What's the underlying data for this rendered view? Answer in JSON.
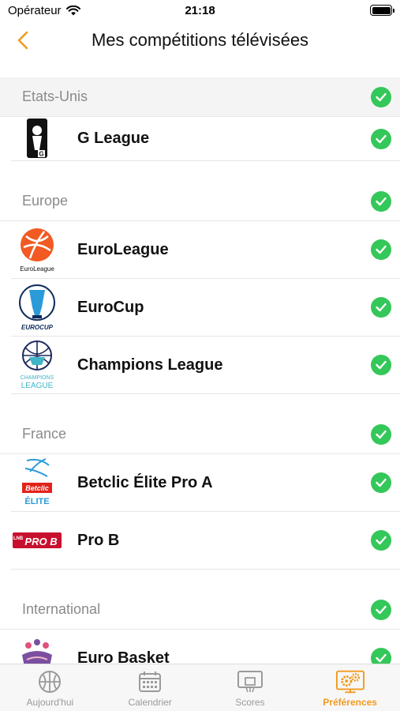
{
  "status": {
    "carrier": "Opérateur",
    "time": "21:18"
  },
  "nav": {
    "title": "Mes compétitions télévisées"
  },
  "sections": [
    {
      "name": "Etats-Unis",
      "items": [
        "G League"
      ]
    },
    {
      "name": "Europe",
      "items": [
        "EuroLeague",
        "EuroCup",
        "Champions League"
      ]
    },
    {
      "name": "France",
      "items": [
        "Betclic Élite Pro A",
        "Pro B"
      ]
    },
    {
      "name": "International",
      "items": [
        "Euro Basket"
      ]
    }
  ],
  "logo_text": {
    "euroleague": "EuroLeague",
    "eurocup": "EUROCUP",
    "champions_1": "CHAMPIONS",
    "champions_2": "LEAGUE",
    "betclic": "Betclic",
    "elite": "ÉLITE",
    "prob": "PRO B",
    "lnb": "LNB"
  },
  "tabs": [
    {
      "label": "Aujourd'hui",
      "icon": "basketball-icon"
    },
    {
      "label": "Calendrier",
      "icon": "calendar-icon"
    },
    {
      "label": "Scores",
      "icon": "scoreboard-icon"
    },
    {
      "label": "Préférences",
      "icon": "settings-gears-icon",
      "active": true
    }
  ],
  "colors": {
    "accent": "#f29a1e",
    "check": "#34c759",
    "section_text": "#8a8a8e"
  }
}
